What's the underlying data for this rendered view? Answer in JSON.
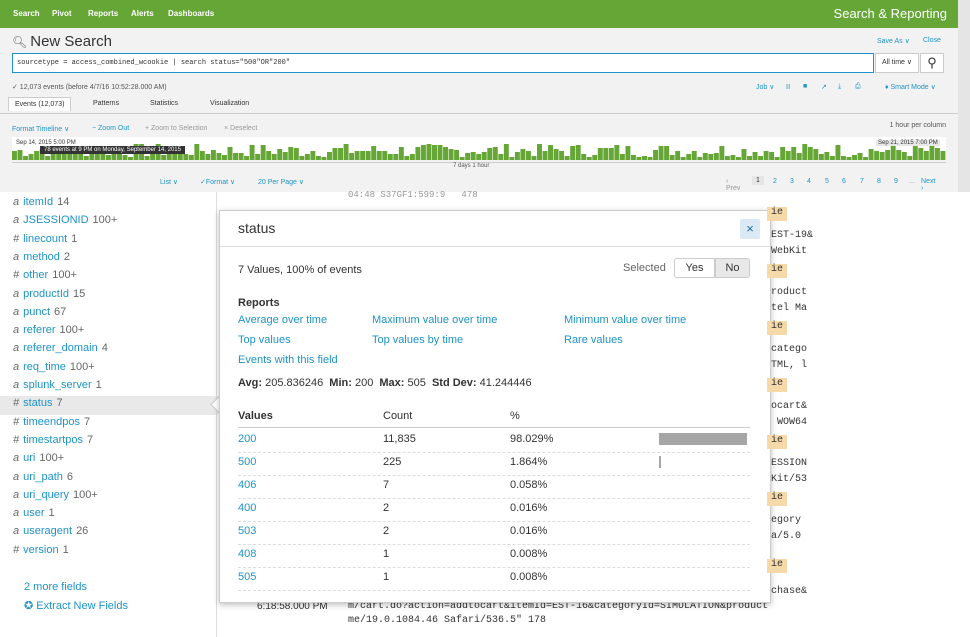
{
  "nav": {
    "items": [
      "Search",
      "Pivot",
      "Reports",
      "Alerts",
      "Dashboards"
    ],
    "app_title": "Search & Reporting"
  },
  "header": {
    "title": "New Search",
    "save_as": "Save As ∨",
    "close": "Close"
  },
  "search": {
    "query": "sourcetype = access_combined_wcookie | search status=\"500\"OR\"200\"",
    "time_range": "All time ∨",
    "meta": "✓ 12,073 events (before 4/7/16 10:52:28.000 AM)",
    "job": "Job ∨",
    "job_icons": [
      "ⅠⅠ",
      "■",
      "↗",
      "⤓",
      "⎙"
    ],
    "smart_mode": "♦ Smart Mode ∨"
  },
  "tabs": [
    "Events (12,073)",
    "Patterns",
    "Statistics",
    "Visualization"
  ],
  "timeline": {
    "format": "Format Timeline ∨",
    "zoom_out": "− Zoom Out",
    "zoom_sel": "+ Zoom to Selection",
    "deselect": "× Deselect",
    "scale": "1 hour per column",
    "start_label": "Sep 14, 2015 5:00 PM",
    "tooltip": "78 events at 9 PM on Monday, September 14, 2015",
    "end_label": "Sep 21, 2015 7:00 PM",
    "span": "7 days 1 hour",
    "bar_color": "#65a637"
  },
  "listbar": {
    "list": "List ∨",
    "format": "✓Format ∨",
    "per_page": "20 Per Page ∨",
    "prev": "‹ Prev",
    "pages": [
      "1",
      "2",
      "3",
      "4",
      "5",
      "6",
      "7",
      "8",
      "9"
    ],
    "ellipsis": "...",
    "next": "Next ›"
  },
  "fields": [
    {
      "type": "a",
      "name": "itemId",
      "count": "14"
    },
    {
      "type": "a",
      "name": "JSESSIONID",
      "count": "100+"
    },
    {
      "type": "#",
      "name": "linecount",
      "count": "1"
    },
    {
      "type": "a",
      "name": "method",
      "count": "2"
    },
    {
      "type": "#",
      "name": "other",
      "count": "100+"
    },
    {
      "type": "a",
      "name": "productId",
      "count": "15"
    },
    {
      "type": "a",
      "name": "punct",
      "count": "67"
    },
    {
      "type": "a",
      "name": "referer",
      "count": "100+"
    },
    {
      "type": "a",
      "name": "referer_domain",
      "count": "4"
    },
    {
      "type": "a",
      "name": "req_time",
      "count": "100+"
    },
    {
      "type": "a",
      "name": "splunk_server",
      "count": "1"
    },
    {
      "type": "#",
      "name": "status",
      "count": "7"
    },
    {
      "type": "#",
      "name": "timeendpos",
      "count": "7"
    },
    {
      "type": "#",
      "name": "timestartpos",
      "count": "7"
    },
    {
      "type": "a",
      "name": "uri",
      "count": "100+"
    },
    {
      "type": "a",
      "name": "uri_path",
      "count": "6"
    },
    {
      "type": "a",
      "name": "uri_query",
      "count": "100+"
    },
    {
      "type": "a",
      "name": "user",
      "count": "1"
    },
    {
      "type": "a",
      "name": "useragent",
      "count": "26"
    },
    {
      "type": "#",
      "name": "version",
      "count": "1"
    }
  ],
  "more_fields": "2 more fields",
  "extract_fields": "✪ Extract New Fields",
  "events": {
    "top_fragment": "04:48 S37GF1:599:9   478",
    "snippets": [
      "ie",
      "EST-19&",
      "WebKit",
      "ie",
      "roduct",
      "tel Ma",
      "ie",
      "catego",
      "TML, l",
      "ie",
      "ocart&",
      " WOW64",
      "ie",
      "ESSION",
      "Kit/53",
      "ie",
      "egory",
      "a/5.0",
      "ie",
      "chase&"
    ],
    "time": "6:18:58.000 PM",
    "line1": "m/cart.do?action=addtocart&itemId=EST-16&categoryId=SIMULATION&product",
    "line2": "me/19.0.1084.46 Safari/536.5\" 178"
  },
  "popup": {
    "title": "status",
    "close": "×",
    "summary": "7 Values, 100% of events",
    "selected_label": "Selected",
    "yes": "Yes",
    "no": "No",
    "reports_heading": "Reports",
    "reports": [
      "Average over time",
      "Maximum value over time",
      "Minimum value over time",
      "Top values",
      "Top values by time",
      "Rare values",
      "Events with this field"
    ],
    "stats": {
      "avg_label": "Avg:",
      "avg": "205.836246",
      "min_label": "Min:",
      "min": "200",
      "max_label": "Max:",
      "max": "505",
      "std_label": "Std Dev:",
      "std": "41.244446"
    },
    "columns": [
      "Values",
      "Count",
      "%"
    ],
    "values": [
      {
        "value": "200",
        "count": "11,835",
        "pct": "98.029%",
        "fraction": 0.98029
      },
      {
        "value": "500",
        "count": "225",
        "pct": "1.864%",
        "fraction": 0.01864
      },
      {
        "value": "406",
        "count": "7",
        "pct": "0.058%",
        "fraction": 0.00058
      },
      {
        "value": "400",
        "count": "2",
        "pct": "0.016%",
        "fraction": 0.00016
      },
      {
        "value": "503",
        "count": "2",
        "pct": "0.016%",
        "fraction": 0.00016
      },
      {
        "value": "408",
        "count": "1",
        "pct": "0.008%",
        "fraction": 8e-05
      },
      {
        "value": "505",
        "count": "1",
        "pct": "0.008%",
        "fraction": 8e-05
      }
    ]
  }
}
